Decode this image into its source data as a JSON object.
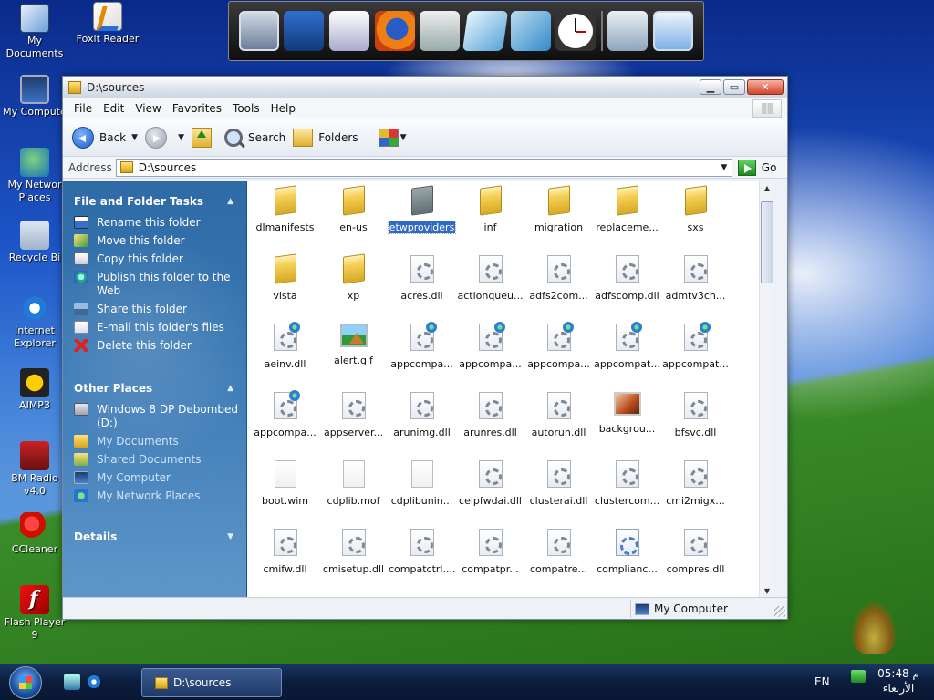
{
  "desktop": {
    "icons": [
      {
        "label": "My\nDocuments",
        "icon": "my-documents-icon"
      },
      {
        "label": "Foxit Reader",
        "icon": "foxit-reader-icon"
      },
      {
        "label": "My Compute",
        "icon": "my-computer-icon"
      },
      {
        "label": "My Networ\nPlaces",
        "icon": "network-places-icon"
      },
      {
        "label": "Recycle Bi",
        "icon": "recycle-bin-icon"
      },
      {
        "label": "Internet\nExplorer",
        "icon": "internet-explorer-icon"
      },
      {
        "label": "AIMP3",
        "icon": "aimp3-icon"
      },
      {
        "label": "BM Radio\nv4.0",
        "icon": "bm-radio-icon"
      },
      {
        "label": "CCleaner",
        "icon": "ccleaner-icon"
      },
      {
        "label": "Flash Player\n9",
        "icon": "flash-player-icon"
      }
    ]
  },
  "dock": {
    "items": [
      "my-computer-icon",
      "network-icon",
      "documents-icon",
      "firefox-icon",
      "calculator-icon",
      "notepad-icon",
      "control-panel-icon",
      "clock-icon",
      "recycle-bin-icon",
      "show-desktop-icon"
    ]
  },
  "window": {
    "title": "D:\\sources",
    "buttons": {
      "minimize": "▁",
      "maximize": "▭",
      "close": "✕"
    }
  },
  "menu": {
    "file": "File",
    "edit": "Edit",
    "view": "View",
    "favorites": "Favorites",
    "tools": "Tools",
    "help": "Help"
  },
  "toolbar": {
    "back": "Back",
    "search": "Search",
    "folders": "Folders",
    "caret": "▼"
  },
  "address": {
    "label": "Address",
    "value": "D:\\sources",
    "go": "Go"
  },
  "taskpane": {
    "file_tasks": {
      "title": "File and Folder Tasks",
      "items": [
        "Rename this folder",
        "Move this folder",
        "Copy this folder",
        "Publish this folder to the Web",
        "Share this folder",
        "E-mail this folder's files",
        "Delete this folder"
      ]
    },
    "other_places": {
      "title": "Other Places",
      "items": [
        "Windows 8 DP Debombed (D:)",
        "My Documents",
        "Shared Documents",
        "My Computer",
        "My Network Places"
      ]
    },
    "details": {
      "title": "Details"
    },
    "chevron_up": "▲",
    "chevron_down": "▼"
  },
  "files": [
    {
      "name": "dlmanifests",
      "type": "folder"
    },
    {
      "name": "en-us",
      "type": "folder"
    },
    {
      "name": "etwproviders",
      "type": "folder-dark",
      "selected": true
    },
    {
      "name": "inf",
      "type": "folder"
    },
    {
      "name": "migration",
      "type": "folder"
    },
    {
      "name": "replaceme...",
      "type": "folder"
    },
    {
      "name": "sxs",
      "type": "folder"
    },
    {
      "name": "vista",
      "type": "folder"
    },
    {
      "name": "xp",
      "type": "folder"
    },
    {
      "name": "acres.dll",
      "type": "dll"
    },
    {
      "name": "actionqueu...",
      "type": "dll"
    },
    {
      "name": "adfs2com...",
      "type": "dll"
    },
    {
      "name": "adfscomp.dll",
      "type": "dll"
    },
    {
      "name": "admtv3ch...",
      "type": "dll"
    },
    {
      "name": "aeinv.dll",
      "type": "dll-globe"
    },
    {
      "name": "alert.gif",
      "type": "gif"
    },
    {
      "name": "appcompa...",
      "type": "dll-globe"
    },
    {
      "name": "appcompa...",
      "type": "dll-globe"
    },
    {
      "name": "appcompa...",
      "type": "dll-globe"
    },
    {
      "name": "appcompat...",
      "type": "dll-globe"
    },
    {
      "name": "appcompat...",
      "type": "dll-globe"
    },
    {
      "name": "appcompa...",
      "type": "dll-globe"
    },
    {
      "name": "appserver...",
      "type": "dll"
    },
    {
      "name": "arunimg.dll",
      "type": "dll"
    },
    {
      "name": "arunres.dll",
      "type": "dll"
    },
    {
      "name": "autorun.dll",
      "type": "dll"
    },
    {
      "name": "backgrou...",
      "type": "bmp"
    },
    {
      "name": "bfsvc.dll",
      "type": "dll"
    },
    {
      "name": "boot.wim",
      "type": "blank"
    },
    {
      "name": "cdplib.mof",
      "type": "blank"
    },
    {
      "name": "cdplibunin...",
      "type": "blank"
    },
    {
      "name": "ceipfwdai.dll",
      "type": "dll"
    },
    {
      "name": "clusterai.dll",
      "type": "dll"
    },
    {
      "name": "clustercom...",
      "type": "dll"
    },
    {
      "name": "cmi2migx...",
      "type": "dll"
    },
    {
      "name": "cmifw.dll",
      "type": "dll"
    },
    {
      "name": "cmisetup.dll",
      "type": "dll"
    },
    {
      "name": "compatctrl....",
      "type": "dll"
    },
    {
      "name": "compatpr...",
      "type": "dll"
    },
    {
      "name": "compatre...",
      "type": "dll"
    },
    {
      "name": "complianc...",
      "type": "inf"
    },
    {
      "name": "compres.dll",
      "type": "dll"
    }
  ],
  "status": {
    "location": "My Computer"
  },
  "taskbar": {
    "window_tab": "D:\\sources",
    "language": "EN",
    "time": "05:48 م",
    "day": "الأربعاء"
  }
}
